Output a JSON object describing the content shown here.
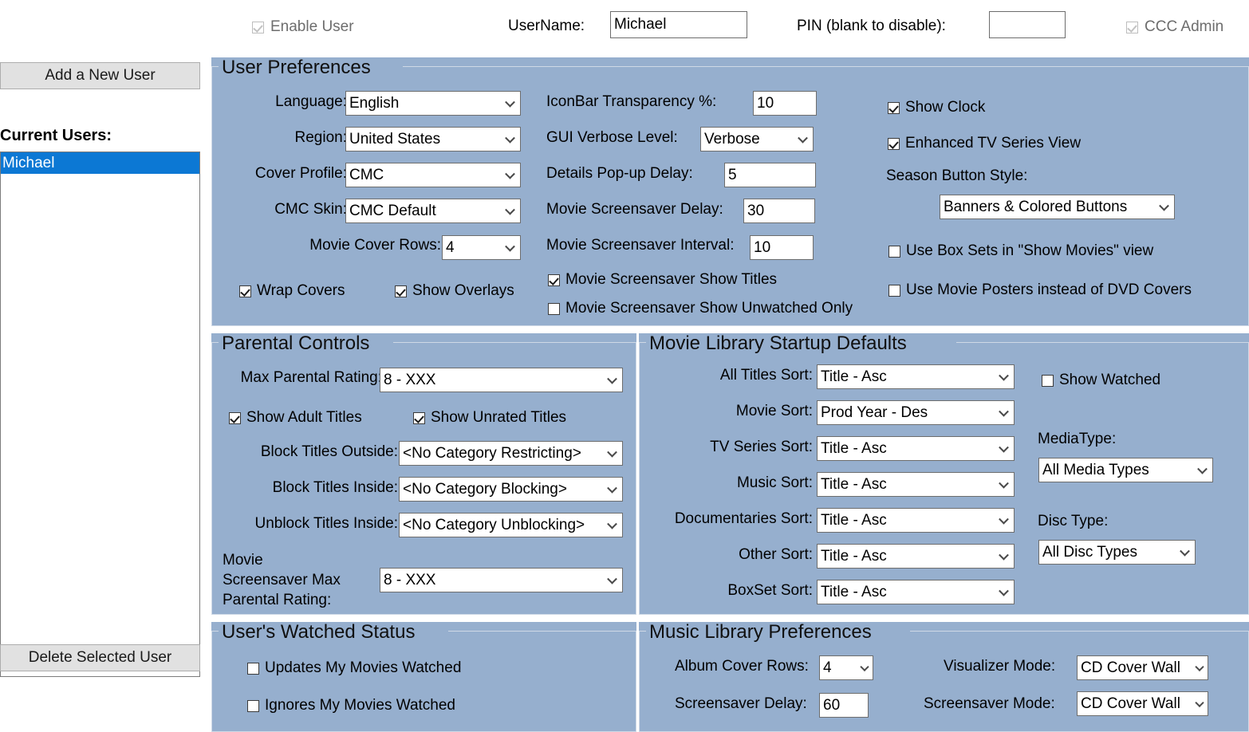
{
  "header": {
    "enable_user": {
      "label": "Enable User",
      "checked": true,
      "disabled": true
    },
    "username": {
      "label": "UserName:",
      "value": "Michael"
    },
    "pin": {
      "label": "PIN (blank to disable):",
      "value": ""
    },
    "ccc_admin": {
      "label": "CCC Admin",
      "checked": true,
      "disabled": true
    }
  },
  "sidebar": {
    "add_user_button": "Add a New User",
    "current_users_label": "Current Users:",
    "users": [
      "Michael"
    ],
    "selected_user": "Michael",
    "delete_user_button": "Delete Selected User"
  },
  "user_preferences": {
    "title": "User Preferences",
    "language": {
      "label": "Language:",
      "value": "English"
    },
    "region": {
      "label": "Region:",
      "value": "United States"
    },
    "cover_profile": {
      "label": "Cover Profile:",
      "value": "CMC"
    },
    "cmc_skin": {
      "label": "CMC Skin:",
      "value": "CMC Default"
    },
    "movie_cover_rows": {
      "label": "Movie Cover Rows:",
      "value": "4"
    },
    "wrap_covers": {
      "label": "Wrap Covers",
      "checked": true
    },
    "show_overlays": {
      "label": "Show Overlays",
      "checked": true
    },
    "iconbar_transparency": {
      "label": "IconBar Transparency %:",
      "value": "10"
    },
    "gui_verbose_level": {
      "label": "GUI Verbose Level:",
      "value": "Verbose"
    },
    "details_popup_delay": {
      "label": "Details Pop-up Delay:",
      "value": "5"
    },
    "movie_screensaver_delay": {
      "label": "Movie Screensaver Delay:",
      "value": "30"
    },
    "movie_screensaver_interval": {
      "label": "Movie Screensaver Interval:",
      "value": "10"
    },
    "screensaver_show_titles": {
      "label": "Movie Screensaver Show Titles",
      "checked": true
    },
    "screensaver_show_unwatched": {
      "label": "Movie Screensaver Show Unwatched Only",
      "checked": false
    },
    "show_clock": {
      "label": "Show Clock",
      "checked": true
    },
    "enhanced_tv_series_view": {
      "label": "Enhanced TV Series View",
      "checked": true
    },
    "season_button_style": {
      "label": "Season Button Style:",
      "value": "Banners & Colored Buttons"
    },
    "use_box_sets": {
      "label": "Use Box Sets in \"Show Movies\" view",
      "checked": false
    },
    "use_movie_posters": {
      "label": "Use Movie Posters instead of DVD Covers",
      "checked": false
    }
  },
  "parental_controls": {
    "title": "Parental Controls",
    "max_parental_rating": {
      "label": "Max Parental Rating:",
      "value": "8 - XXX"
    },
    "show_adult_titles": {
      "label": "Show Adult Titles",
      "checked": true
    },
    "show_unrated_titles": {
      "label": "Show Unrated Titles",
      "checked": true
    },
    "block_titles_outside": {
      "label": "Block Titles Outside:",
      "value": "<No Category Restricting>"
    },
    "block_titles_inside": {
      "label": "Block Titles Inside:",
      "value": "<No Category Blocking>"
    },
    "unblock_titles_inside": {
      "label": "Unblock Titles Inside:",
      "value": "<No Category Unblocking>"
    },
    "screensaver_max_rating": {
      "label": "Movie\nScreensaver Max\nParental Rating:",
      "value": "8 - XXX"
    }
  },
  "movie_library_startup_defaults": {
    "title": "Movie Library Startup Defaults",
    "all_titles_sort": {
      "label": "All Titles Sort:",
      "value": "Title - Asc"
    },
    "movie_sort": {
      "label": "Movie Sort:",
      "value": "Prod Year - Des"
    },
    "tv_series_sort": {
      "label": "TV Series Sort:",
      "value": "Title - Asc"
    },
    "music_sort": {
      "label": "Music Sort:",
      "value": "Title - Asc"
    },
    "documentaries_sort": {
      "label": "Documentaries Sort:",
      "value": "Title - Asc"
    },
    "other_sort": {
      "label": "Other Sort:",
      "value": "Title - Asc"
    },
    "boxset_sort": {
      "label": "BoxSet Sort:",
      "value": "Title - Asc"
    },
    "show_watched": {
      "label": "Show Watched",
      "checked": false
    },
    "media_type": {
      "label": "MediaType:",
      "value": "All Media Types"
    },
    "disc_type": {
      "label": "Disc Type:",
      "value": "All Disc Types"
    }
  },
  "users_watched_status": {
    "title": "User's Watched Status",
    "updates_my_movies_watched": {
      "label": "Updates My Movies Watched",
      "checked": false
    },
    "ignores_my_movies_watched": {
      "label": "Ignores My Movies Watched",
      "checked": false
    }
  },
  "music_library_preferences": {
    "title": "Music Library Preferences",
    "album_cover_rows": {
      "label": "Album Cover Rows:",
      "value": "4"
    },
    "screensaver_delay": {
      "label": "Screensaver Delay:",
      "value": "60"
    },
    "visualizer_mode": {
      "label": "Visualizer Mode:",
      "value": "CD Cover Wall"
    },
    "screensaver_mode": {
      "label": "Screensaver Mode:",
      "value": "CD Cover Wall"
    }
  },
  "colors": {
    "panel_blue": "#96afce",
    "selection_blue": "#0c78d4",
    "button_gray": "#e1e1e1"
  }
}
